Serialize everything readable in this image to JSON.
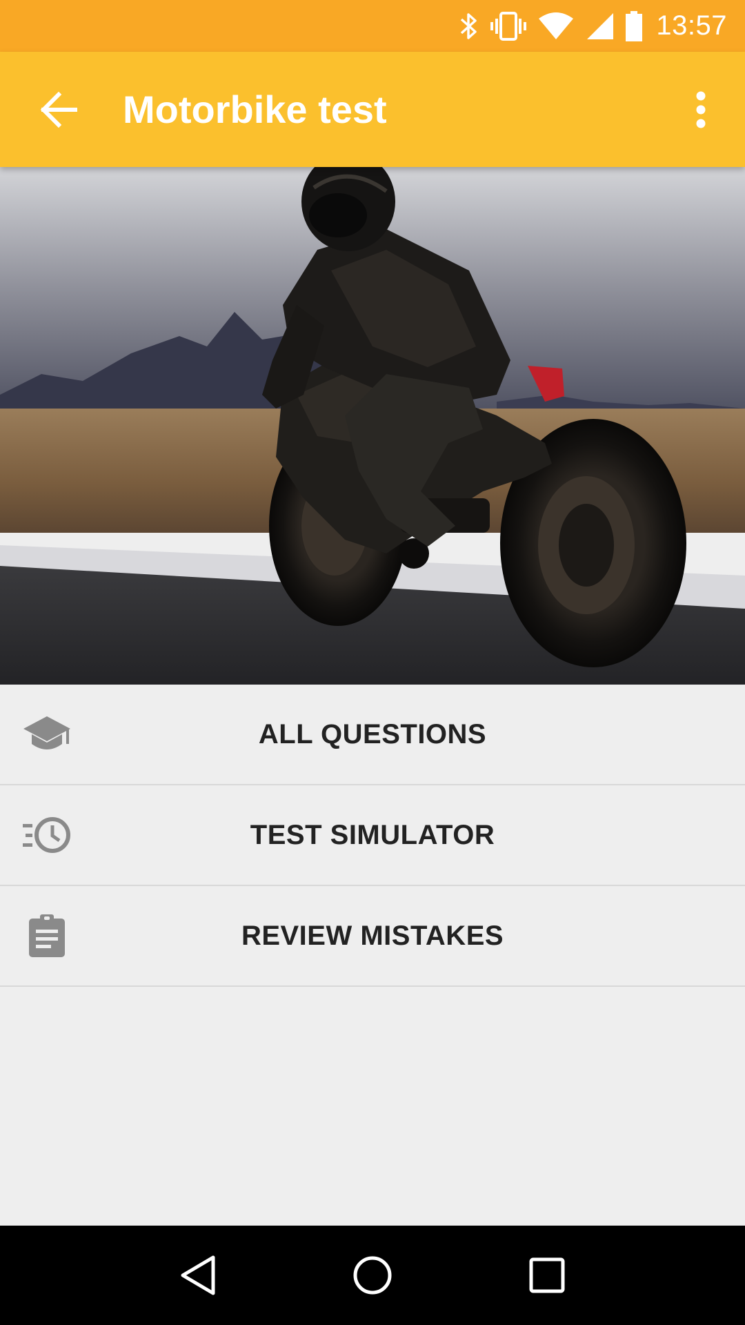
{
  "status_bar": {
    "time": "13:57",
    "icons": [
      "bluetooth-icon",
      "vibrate-icon",
      "wifi-icon",
      "signal-icon",
      "battery-icon"
    ]
  },
  "app_bar": {
    "title": "Motorbike test",
    "back_icon": "arrow-back-icon",
    "overflow_icon": "more-vert-icon",
    "background": "#fbc02d",
    "status_background": "#f9a825"
  },
  "hero": {
    "image": "motorcyclist-on-road-photo"
  },
  "menu": {
    "items": [
      {
        "label": "ALL QUESTIONS",
        "icon": "graduation-cap-icon"
      },
      {
        "label": "TEST SIMULATOR",
        "icon": "timer-history-icon"
      },
      {
        "label": "REVIEW MISTAKES",
        "icon": "clipboard-icon"
      }
    ]
  },
  "nav_bar": {
    "icons": [
      "back-triangle-icon",
      "home-circle-icon",
      "recents-square-icon"
    ]
  }
}
